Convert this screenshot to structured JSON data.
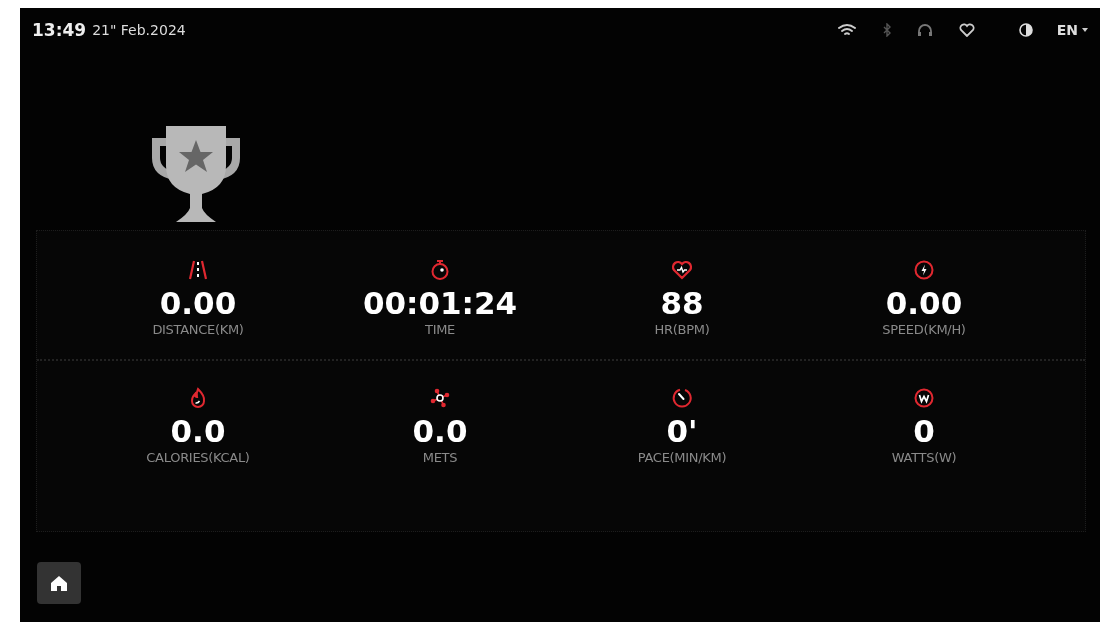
{
  "status_bar": {
    "time": "13:49",
    "date": "21\" Feb.2024",
    "language": "EN"
  },
  "metrics": [
    {
      "kind": "distance",
      "value": "0.00",
      "label": "DISTANCE(KM)"
    },
    {
      "kind": "time",
      "value": "00:01:24",
      "label": "TIME"
    },
    {
      "kind": "heart-rate",
      "value": "88",
      "label": "HR(BPM)"
    },
    {
      "kind": "speed",
      "value": "0.00",
      "label": "SPEED(KM/H)"
    },
    {
      "kind": "calories",
      "value": "0.0",
      "label": "CALORIES(KCAL)"
    },
    {
      "kind": "mets",
      "value": "0.0",
      "label": "METS"
    },
    {
      "kind": "pace",
      "value": "0'",
      "label": "PACE(MIN/KM)"
    },
    {
      "kind": "watts",
      "value": "0",
      "label": "WATTS(W)"
    }
  ]
}
